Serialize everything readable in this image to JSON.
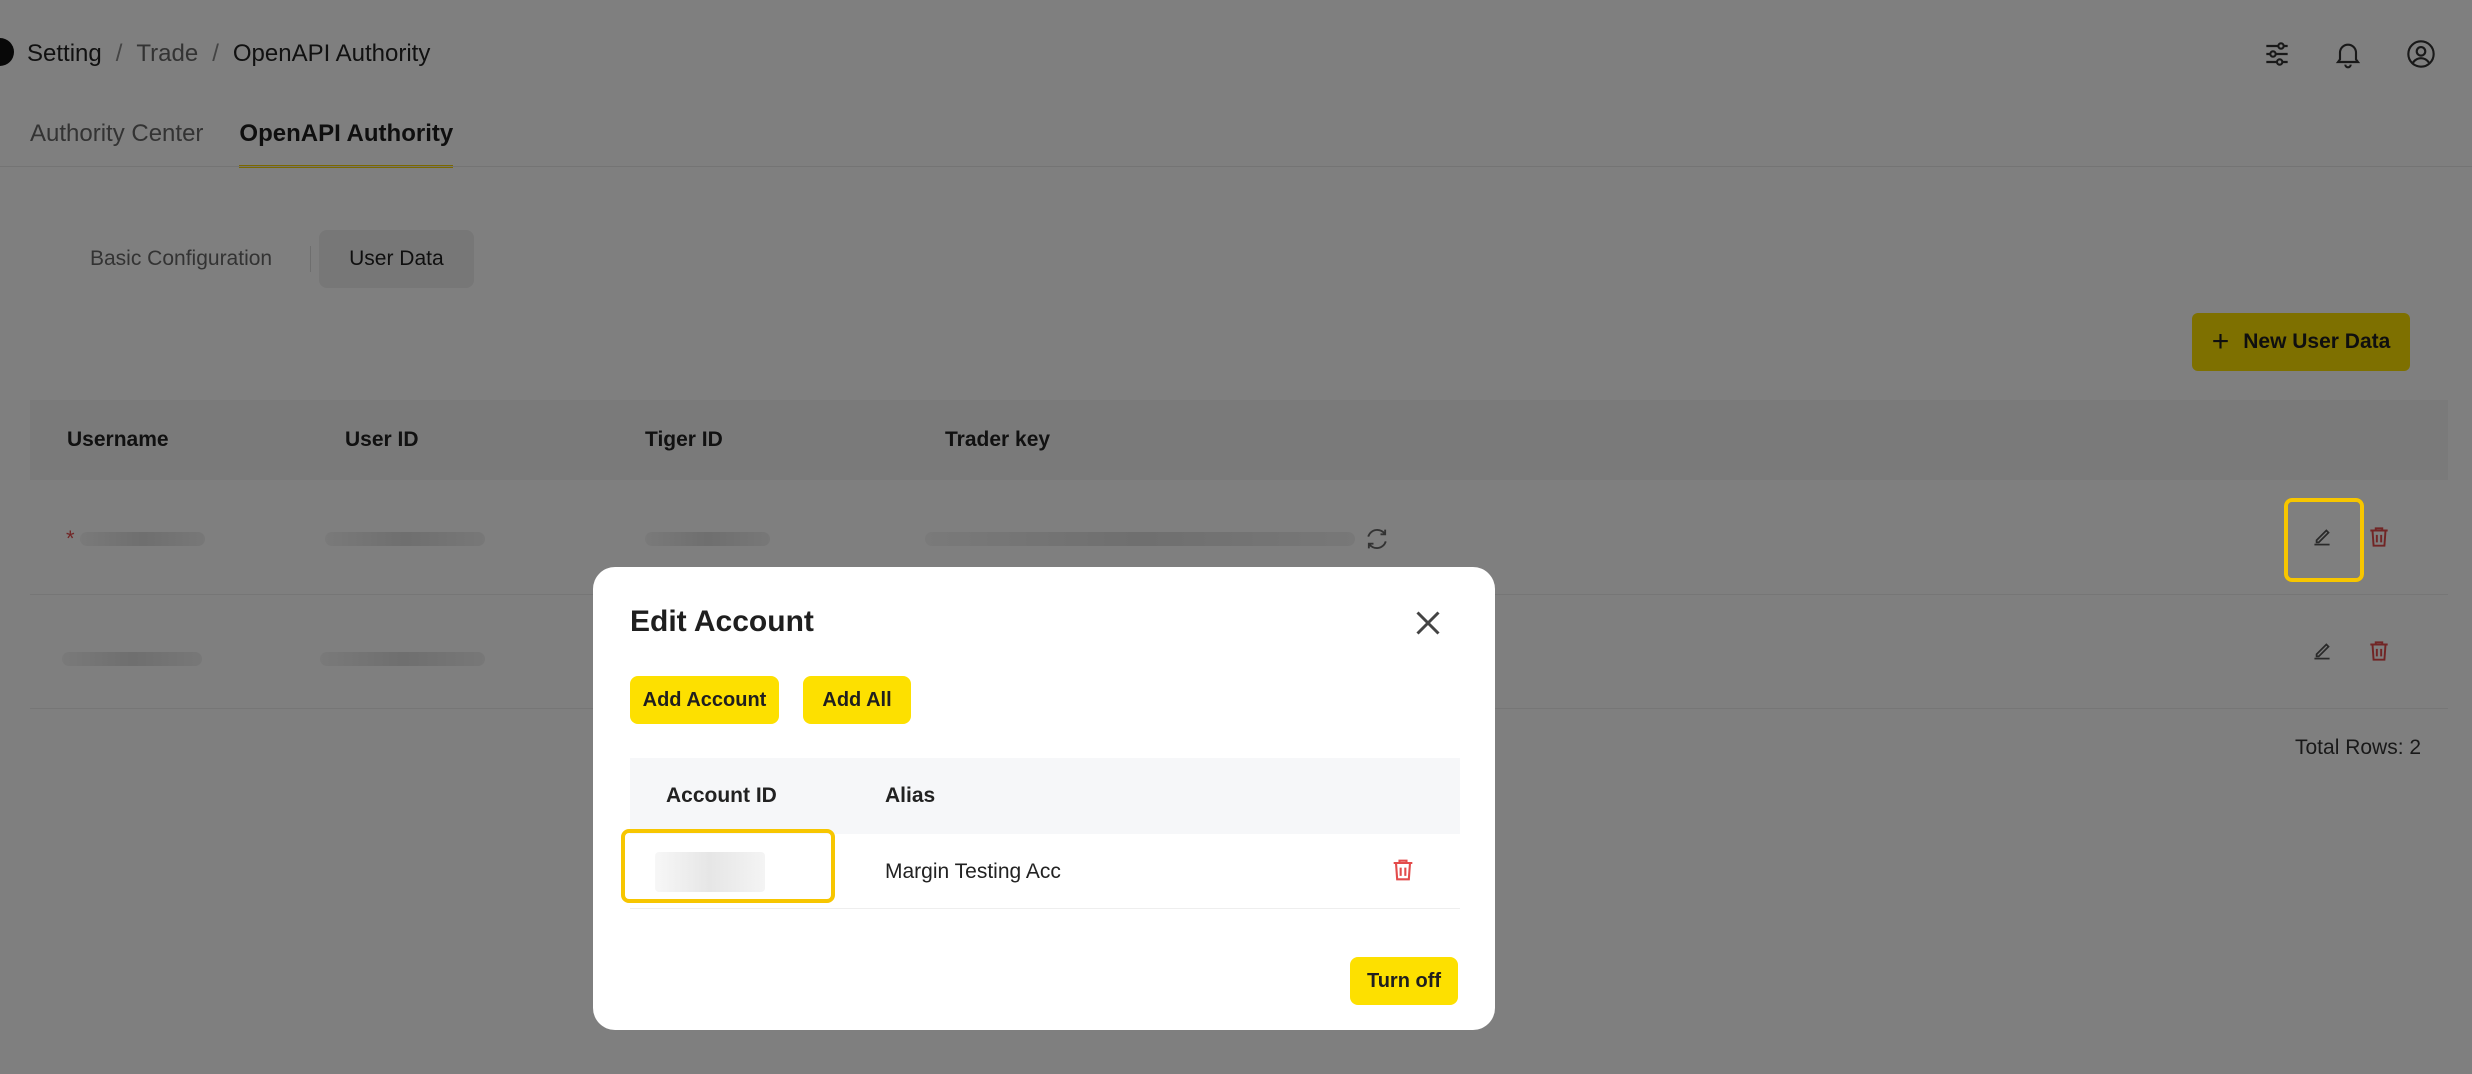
{
  "breadcrumb": [
    "Setting",
    "Trade",
    "OpenAPI Authority"
  ],
  "breadcrumb_sep": "/",
  "header_icons": [
    "sliders-icon",
    "bell-icon",
    "user-circle-icon"
  ],
  "main_tabs": [
    "Authority Center",
    "OpenAPI Authority"
  ],
  "main_tab_active": "OpenAPI Authority",
  "sub_tabs": [
    "Basic Configuration",
    "User Data"
  ],
  "sub_tab_active": "User Data",
  "new_button": {
    "icon": "plus-icon",
    "label": "New User Data"
  },
  "table": {
    "columns": [
      "Username",
      "User ID",
      "Tiger ID",
      "Trader key"
    ],
    "rows": [
      {
        "required_marker": "*",
        "row_actions": [
          "edit-icon",
          "trash-icon"
        ]
      },
      {
        "row_actions": [
          "edit-icon",
          "trash-icon"
        ]
      }
    ],
    "total_rows": "Total Rows: 2"
  },
  "modal": {
    "title": "Edit Account",
    "buttons": {
      "add_account": "Add Account",
      "add_all": "Add All"
    },
    "columns": [
      "Account ID",
      "Alias"
    ],
    "rows": [
      {
        "alias": "Margin Testing Acc"
      }
    ],
    "turn_off": "Turn off"
  },
  "colors": {
    "accent": "#fde000",
    "highlight": "#f7c600",
    "danger": "#e34b4b",
    "overlay": "rgba(0,0,0,0.5)"
  }
}
